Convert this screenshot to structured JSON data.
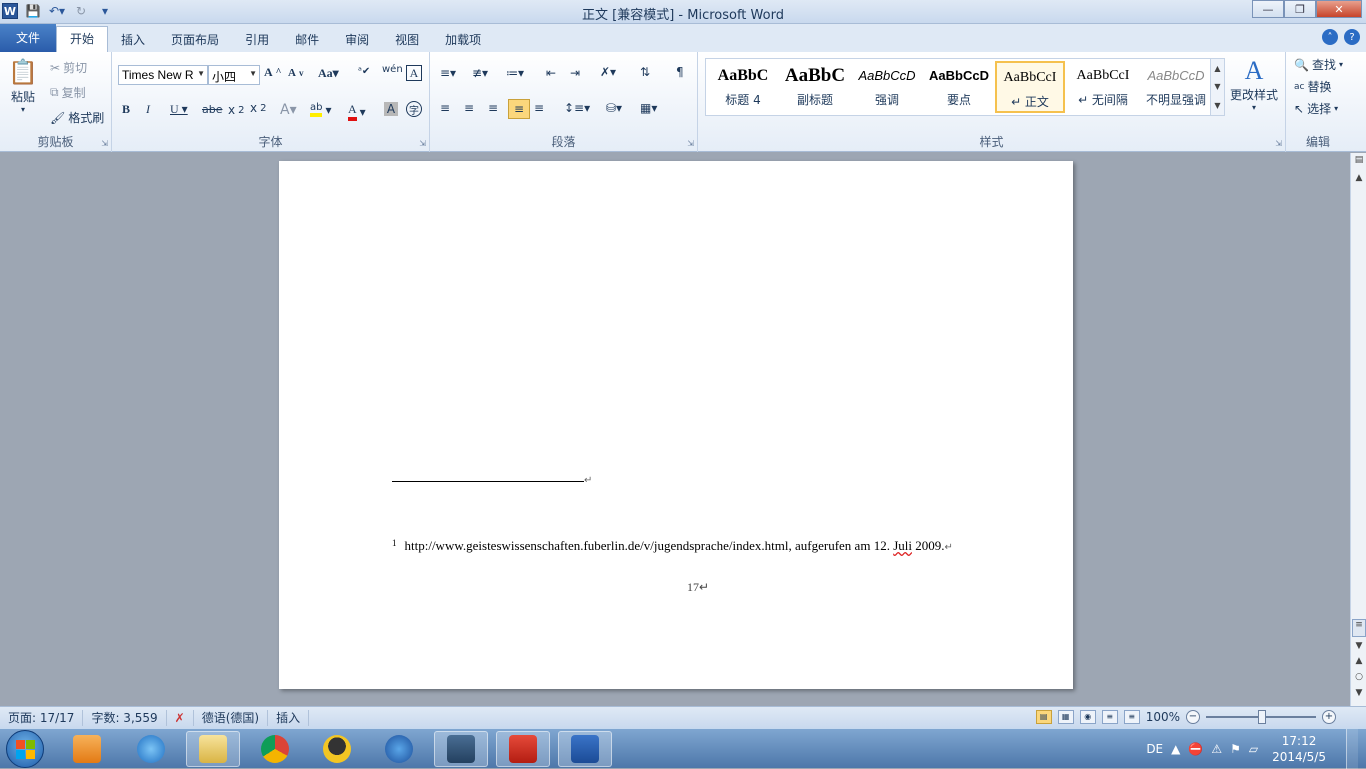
{
  "window": {
    "title": "正文 [兼容模式]  -  Microsoft Word"
  },
  "qat": {
    "logo": "W"
  },
  "tabs": [
    "文件",
    "开始",
    "插入",
    "页面布局",
    "引用",
    "邮件",
    "审阅",
    "视图",
    "加载项"
  ],
  "clipboard": {
    "paste": "粘贴",
    "cut": "剪切",
    "copy": "复制",
    "format_painter": "格式刷",
    "label": "剪贴板"
  },
  "font": {
    "name": "Times New R",
    "size": "小四",
    "label": "字体"
  },
  "paragraph": {
    "label": "段落"
  },
  "styles": {
    "label": "样式",
    "items": [
      {
        "sample": "AaBbC",
        "name": "标题 4"
      },
      {
        "sample": "AaBbC",
        "name": "副标题"
      },
      {
        "sample": "AaBbCcD",
        "name": "强调"
      },
      {
        "sample": "AaBbCcD",
        "name": "要点"
      },
      {
        "sample": "AaBbCcI",
        "name": "↵ 正文"
      },
      {
        "sample": "AaBbCcI",
        "name": "↵ 无间隔"
      },
      {
        "sample": "AaBbCcD",
        "name": "不明显强调"
      }
    ],
    "change": "更改样式"
  },
  "editing": {
    "find": "查找",
    "replace": "替换",
    "select": "选择",
    "label": "编辑"
  },
  "document": {
    "footnote_sep_mark": "↵",
    "footnote_num": "1",
    "footnote_text_a": "http://www.geisteswissenschaften.fuberlin.de/v/jugendsprache/index.html, aufgerufen am 12. ",
    "footnote_text_b": "Juli",
    "footnote_text_c": " 2009.",
    "para_mark": "↵",
    "page_number": "17↵"
  },
  "status": {
    "page": "页面: 17/17",
    "words": "字数: 3,559",
    "language": "德语(德国)",
    "mode": "插入",
    "zoom": "100%"
  },
  "taskbar": {
    "time": "17:12",
    "date": "2014/5/5",
    "lang": "DE"
  }
}
